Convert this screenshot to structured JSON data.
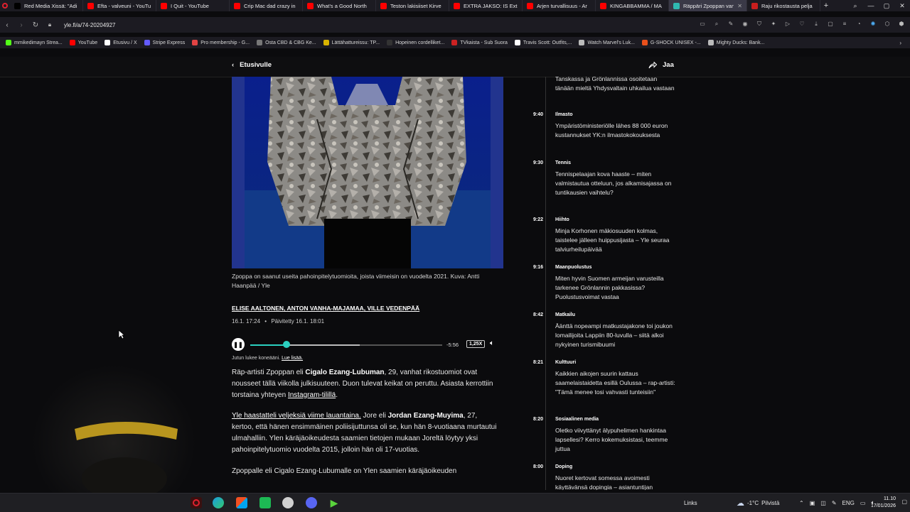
{
  "browser": {
    "tabs": [
      {
        "label": "Red Media Xissä: \"Adi",
        "color": "#000000",
        "active": false
      },
      {
        "label": "Efta - valveuni - YouTu",
        "color": "#ff0000",
        "active": false
      },
      {
        "label": "I Quit - YouTube",
        "color": "#ff0000",
        "active": false
      },
      {
        "label": "Crip Mac dad crazy in",
        "color": "#ff0000",
        "active": false
      },
      {
        "label": "What's a Good North",
        "color": "#ff0000",
        "active": false
      },
      {
        "label": "Teston lakisiiset Kirve",
        "color": "#ff0000",
        "active": false
      },
      {
        "label": "EXTRA JAKSO: IS Extra",
        "color": "#ff0000",
        "active": false
      },
      {
        "label": "Arjen turvallisuus - Ar",
        "color": "#ff0000",
        "active": false
      },
      {
        "label": "KINGABBAMMA / MA",
        "color": "#ff0000",
        "active": false
      },
      {
        "label": "Räppäri Zpoppan van",
        "color": "#2fb8b0",
        "active": true
      },
      {
        "label": "Raju rikostausta pelja",
        "color": "#c81e1e",
        "active": false
      }
    ],
    "new_tab": "+",
    "url": "yle.fi/a/74-20204927",
    "bookmarks": [
      {
        "label": "mmikedimayn Strea...",
        "color": "#53fc18"
      },
      {
        "label": "YouTube",
        "color": "#ff0000"
      },
      {
        "label": "Etusivu / X",
        "color": "#ffffff"
      },
      {
        "label": "Stripe Express",
        "color": "#635bff"
      },
      {
        "label": "Pro membership - G...",
        "color": "#e24343"
      },
      {
        "label": "Osta CBD & CBG Ke...",
        "color": "#777777"
      },
      {
        "label": "Lättähattureissu: TP...",
        "color": "#d9b300"
      },
      {
        "label": "Hopeinen cordelliket...",
        "color": "#333333"
      },
      {
        "label": "TVkaista - Sub Suora",
        "color": "#cc2222"
      },
      {
        "label": "Travis Scott: Outfits,...",
        "color": "#ffffff"
      },
      {
        "label": "Watch Marvel's Luk...",
        "color": "#bbbbbb"
      },
      {
        "label": "G-SHOCK UNISEX -...",
        "color": "#e8501b"
      },
      {
        "label": "Mighty Ducks: Bank...",
        "color": "#bbbbbb"
      }
    ]
  },
  "page_header": {
    "back_label": "Etusivulle",
    "share_label": "Jaa"
  },
  "article": {
    "caption": "Zpoppa on saanut useita pahoinpitelytuomioita, joista viimeisin on vuodelta 2021. Kuva: Antti Haanpää / Yle",
    "authors": [
      "Elise Aaltonen",
      "Anton Vanha-Majamaa",
      "Ville Vedenpää"
    ],
    "published": "16.1. 17:24",
    "separator": "•",
    "updated": "Päivitetty 16.1. 18:01",
    "player": {
      "play_icon": "pause-icon",
      "progress": 0.19,
      "buffered": 0.57,
      "remaining": "-5:56",
      "speed": "1,25X"
    },
    "read_by": "Jutun lukee koneääni.",
    "read_more": "Lue lisää.",
    "paragraphs": [
      {
        "p1": "Räp-artisti Zpoppan eli ",
        "b1": "Cigalo Ezang-Lubuman",
        "p2": ", 29, vanhat rikostuomiot ovat nousseet tällä viikolla julkisuuteen. Duon tulevat keikat on peruttu. Asiasta kerrottiin torstaina yhteyen ",
        "link": "Instagram-tilillä",
        "p3": "."
      },
      {
        "link": "Yle haastatteli veljeksiä viime lauantaina.",
        "p1": " Jore eli ",
        "b1": "Jordan Ezang-Muyima",
        "p2": ", 27, kertoo, että hänen ensimmäinen poliisijuttunsa oli se, kun hän 8-vuotiaana murtautui ulmahalliin. Ylen käräjäoikeudesta saamien tietojen mukaan Joreltä löytyy yksi pahoinpitelytuomio vuodelta 2015, jolloin hän oli 17-vuotias."
      },
      {
        "p1": "Zpoppalle eli Cigalo Ezang-Lubumalle on Ylen saamien käräjäoikeuden"
      }
    ]
  },
  "feed": [
    {
      "time": "",
      "category": "",
      "headline": "Tanskassa ja Grönlannissa osoitetaan tänään mieltä Yhdysvaltain uhkailua vastaan"
    },
    {
      "time": "9:40",
      "category": "Ilmasto",
      "headline": "Ympäristöministeriölle lähes 88 000 euron kustannukset YK:n ilmastokokouksesta"
    },
    {
      "time": "9:30",
      "category": "Tennis",
      "headline": "Tennispelaajan kova haaste – miten valmistautua otteluun, jos alkamisajassa on tuntikausien vaihtelu?"
    },
    {
      "time": "9:22",
      "category": "Hiihto",
      "headline": "Minja Korhonen mäkiosuuden kolmas, taistelee jälleen huippusijasta – Yle seuraa talviurheilupäivää"
    },
    {
      "time": "9:16",
      "category": "Maanpuolustus",
      "headline": "Miten hyvin Suomen armeijan varusteilla tarkenee Grönlannin pakkasissa? Puolustusvoimat vastaa"
    },
    {
      "time": "8:42",
      "category": "Matkailu",
      "headline": "Äänttä nopeampi matkustajakone toi joukon lomailijoita Lappiin 80-luvulla – siitä alkoi nykyinen turismibuumi"
    },
    {
      "time": "8:21",
      "category": "Kulttuuri",
      "headline": "Kaikkien aikojen suurin kattaus saamelaistaidetta esillä Oulussa – rap-artisti: \"Tämä menee tosi vahvasti tunteisiin\""
    },
    {
      "time": "8:20",
      "category": "Sosiaalinen media",
      "headline": "Oletko viivyttänyt älypuhelimen hankintaa lapsellesi? Kerro kokemuksistasi, teemme juttua"
    },
    {
      "time": "8:00",
      "category": "Doping",
      "headline": "Nuoret kertovat somessa avoimesti käyttävänsä dopingia – asiantuntijan"
    }
  ],
  "taskbar": {
    "links_label": "Links",
    "weather": "-1°C",
    "weather_desc": "Pilvistä",
    "lang": "ENG",
    "time": "11.10",
    "date": "17/01/2026"
  }
}
